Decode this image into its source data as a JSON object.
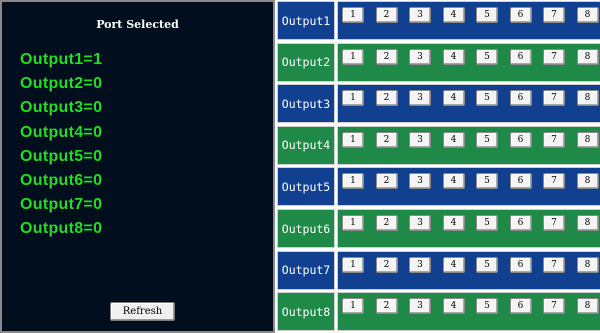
{
  "left_panel": {
    "title": "Port Selected",
    "status_lines": [
      "Output1=1",
      "Output2=0",
      "Output3=0",
      "Output4=0",
      "Output5=0",
      "Output6=0",
      "Output7=0",
      "Output8=0"
    ],
    "refresh_label": "Refresh"
  },
  "outputs": [
    {
      "label": "Output1",
      "color": "blue",
      "buttons": [
        "1",
        "2",
        "3",
        "4",
        "5",
        "6",
        "7",
        "8"
      ]
    },
    {
      "label": "Output2",
      "color": "green",
      "buttons": [
        "1",
        "2",
        "3",
        "4",
        "5",
        "6",
        "7",
        "8"
      ]
    },
    {
      "label": "Output3",
      "color": "blue",
      "buttons": [
        "1",
        "2",
        "3",
        "4",
        "5",
        "6",
        "7",
        "8"
      ]
    },
    {
      "label": "Output4",
      "color": "green",
      "buttons": [
        "1",
        "2",
        "3",
        "4",
        "5",
        "6",
        "7",
        "8"
      ]
    },
    {
      "label": "Output5",
      "color": "blue",
      "buttons": [
        "1",
        "2",
        "3",
        "4",
        "5",
        "6",
        "7",
        "8"
      ]
    },
    {
      "label": "Output6",
      "color": "green",
      "buttons": [
        "1",
        "2",
        "3",
        "4",
        "5",
        "6",
        "7",
        "8"
      ]
    },
    {
      "label": "Output7",
      "color": "blue",
      "buttons": [
        "1",
        "2",
        "3",
        "4",
        "5",
        "6",
        "7",
        "8"
      ]
    },
    {
      "label": "Output8",
      "color": "green",
      "buttons": [
        "1",
        "2",
        "3",
        "4",
        "5",
        "6",
        "7",
        "8"
      ]
    }
  ],
  "colors": {
    "panel_bg": "#000e1e",
    "status_text": "#22dd22",
    "row_blue": "#124090",
    "row_green": "#1f8a48"
  }
}
